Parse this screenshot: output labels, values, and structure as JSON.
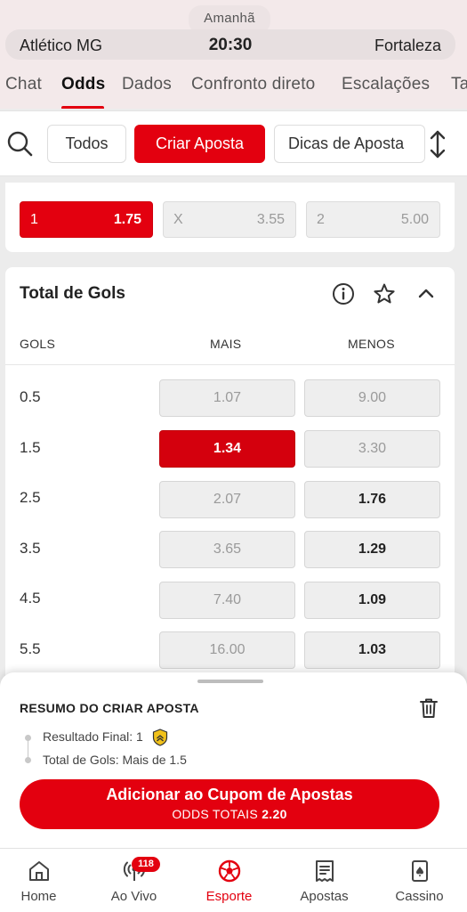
{
  "header": {
    "date_label": "Amanhã",
    "home_team": "Atlético MG",
    "time": "20:30",
    "away_team": "Fortaleza"
  },
  "tabs": [
    {
      "label": "Chat"
    },
    {
      "label": "Odds",
      "active": true
    },
    {
      "label": "Dados"
    },
    {
      "label": "Confronto direto"
    },
    {
      "label": "Escalações"
    },
    {
      "label": "Ta"
    }
  ],
  "filters": {
    "search_icon": "search-icon",
    "chips": [
      {
        "label": "Todos"
      },
      {
        "label": "Criar Aposta",
        "active": true
      },
      {
        "label": "Dicas de Aposta"
      }
    ],
    "sort_icon": "sort-icon"
  },
  "result_market": {
    "options": [
      {
        "label": "1",
        "odds": "1.75",
        "selected": true
      },
      {
        "label": "X",
        "odds": "3.55"
      },
      {
        "label": "2",
        "odds": "5.00"
      }
    ]
  },
  "goals_market": {
    "title": "Total de Gols",
    "icons": [
      "info-icon",
      "star-icon",
      "chevron-up-icon"
    ],
    "columns": {
      "line": "GOLS",
      "over": "MAIS",
      "under": "MENOS"
    },
    "rows": [
      {
        "line": "0.5",
        "over": "1.07",
        "under": "9.00"
      },
      {
        "line": "1.5",
        "over": "1.34",
        "under": "3.30",
        "over_selected": true
      },
      {
        "line": "2.5",
        "over": "2.07",
        "under": "1.76"
      },
      {
        "line": "3.5",
        "over": "3.65",
        "under": "1.29"
      },
      {
        "line": "4.5",
        "over": "7.40",
        "under": "1.09"
      },
      {
        "line": "5.5",
        "over": "16.00",
        "under": "1.03"
      }
    ]
  },
  "bet_slip": {
    "title": "RESUMO DO CRIAR APOSTA",
    "selections": [
      {
        "text": "Resultado Final: 1"
      },
      {
        "text": "Total de Gols: Mais de 1.5"
      }
    ],
    "add_button": "Adicionar ao Cupom de Apostas",
    "total_label": "ODDS TOTAIS",
    "total_odds": "2.20"
  },
  "bottom_nav": [
    {
      "label": "Home",
      "icon": "home-icon"
    },
    {
      "label": "Ao Vivo",
      "icon": "live-icon",
      "badge": "118"
    },
    {
      "label": "Esporte",
      "icon": "soccer-ball-icon",
      "active": true
    },
    {
      "label": "Apostas",
      "icon": "betslip-icon"
    },
    {
      "label": "Cassino",
      "icon": "cards-icon"
    }
  ],
  "colors": {
    "accent": "#e3000f",
    "header_bg": "#f3e9ea",
    "page_bg": "#ececec"
  }
}
